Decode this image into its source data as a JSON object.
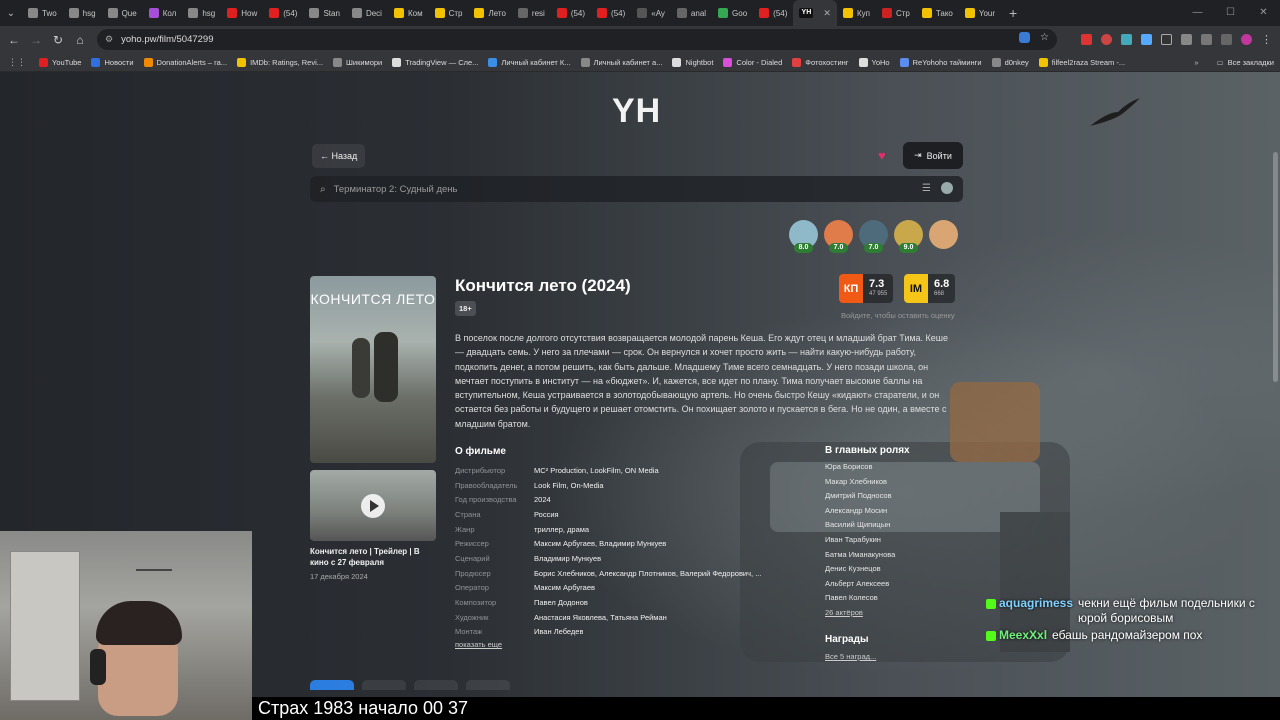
{
  "browser": {
    "tabs": [
      {
        "label": "Two",
        "color": "#888"
      },
      {
        "label": "hsg",
        "color": "#888"
      },
      {
        "label": "Que",
        "color": "#888"
      },
      {
        "label": "Кол",
        "color": "#a64ed6"
      },
      {
        "label": "hsg",
        "color": "#888"
      },
      {
        "label": "How",
        "color": "#e02020"
      },
      {
        "label": "(54)",
        "color": "#e02020"
      },
      {
        "label": "Stan",
        "color": "#888"
      },
      {
        "label": "Deci",
        "color": "#888"
      },
      {
        "label": "Ком",
        "color": "#f2c200"
      },
      {
        "label": "Стр",
        "color": "#f2c200"
      },
      {
        "label": "Лето",
        "color": "#f2c200"
      },
      {
        "label": "resi",
        "color": "#666"
      },
      {
        "label": "(54)",
        "color": "#e02020"
      },
      {
        "label": "(54)",
        "color": "#e02020"
      },
      {
        "label": "«Ay",
        "color": "#555"
      },
      {
        "label": "anal",
        "color": "#666"
      },
      {
        "label": "Goo",
        "color": "#34a853"
      },
      {
        "label": "(54)",
        "color": "#e02020"
      },
      {
        "label": "",
        "color": "#111",
        "active": true
      },
      {
        "label": "Куп",
        "color": "#f2c200"
      },
      {
        "label": "Стр",
        "color": "#cc2222"
      },
      {
        "label": "Тако",
        "color": "#f2c200"
      },
      {
        "label": "Your",
        "color": "#f2c200"
      }
    ],
    "active_tab_icon": "YH",
    "url": "yoho.pw/film/5047299"
  },
  "bookmarks": [
    {
      "label": "YouTube",
      "color": "#e02020"
    },
    {
      "label": "Новости",
      "color": "#2f6fdf"
    },
    {
      "label": "DonationAlerts – га...",
      "color": "#f08a00"
    },
    {
      "label": "IMDb: Ratings, Revi...",
      "color": "#f2c200"
    },
    {
      "label": "Шикимори",
      "color": "#888"
    },
    {
      "label": "TradingView — Сле...",
      "color": "#ddd"
    },
    {
      "label": "Личный кабинет К...",
      "color": "#3a8ee6"
    },
    {
      "label": "Личный кабинет а...",
      "color": "#888"
    },
    {
      "label": "Nightbot",
      "color": "#ddd"
    },
    {
      "label": "Color - Dialed",
      "color": "#d94fd9"
    },
    {
      "label": "Фотохостинг",
      "color": "#e04040"
    },
    {
      "label": "YoHo",
      "color": "#ddd"
    },
    {
      "label": "ReYohoho тайминги",
      "color": "#5a8dee"
    },
    {
      "label": "d0nkey",
      "color": "#888"
    },
    {
      "label": "filfeel2raza Stream -...",
      "color": "#f2c200"
    }
  ],
  "bookmarks_all": "Все закладки",
  "site": {
    "logo": "YH",
    "back": "← Назад",
    "login": "Войти",
    "search_placeholder": "Терминатор 2: Судный день",
    "avatar_scores": [
      "8.0",
      "7.0",
      "7.0",
      "9.0",
      ""
    ]
  },
  "film": {
    "title": "Кончится лето (2024)",
    "age": "18+",
    "poster_text": "КОНЧИТСЯ ЛЕТО",
    "kp_logo": "КП",
    "kp_rating": "7.3",
    "kp_votes": "47 955",
    "imdb_logo": "IM",
    "imdb_rating": "6.8",
    "imdb_votes": "668",
    "rate_hint": "Войдите, чтобы оставить оценку",
    "description": "В поселок после долгого отсутствия возвращается молодой парень Кеша. Его ждут отец и младший брат Тима. Кеше — двадцать семь. У него за плечами — срок. Он вернулся и хочет просто жить — найти какую-нибудь работу, подкопить денег, а потом решить, как быть дальше. Младшему Тиме всего семнадцать. У него позади школа, он мечтает поступить в институт — на «бюджет». И, кажется, все идет по плану. Тима получает высокие баллы на вступительном, Кеша устраивается в золотодобывающую артель. Но очень быстро Кешу «кидают» старатели, и он остается без работы и будущего и решает отомстить. Он похищает золото и пускается в бега. Но не один, а вместе с младшим братом.",
    "about_title": "О фильме",
    "info": [
      {
        "k": "Дистрибьютор",
        "v": "MC² Production, LookFilm, ON Media"
      },
      {
        "k": "Правообладатель",
        "v": "Look Film, On-Media"
      },
      {
        "k": "Год производства",
        "v": "2024"
      },
      {
        "k": "Страна",
        "v": "Россия"
      },
      {
        "k": "Жанр",
        "v": "триллер, драма"
      },
      {
        "k": "Режиссер",
        "v": "Максим Арбугаев, Владимир Мункуев"
      },
      {
        "k": "Сценарий",
        "v": "Владимир Мункуев"
      },
      {
        "k": "Продюсер",
        "v": "Борис Хлебников, Александр Плотников, Валерий Федорович, ..."
      },
      {
        "k": "Оператор",
        "v": "Максим Арбугаев"
      },
      {
        "k": "Композитор",
        "v": "Павел Додонов"
      },
      {
        "k": "Художник",
        "v": "Анастасия Яковлева, Татьяна Рейман"
      },
      {
        "k": "Монтаж",
        "v": "Иван Лебедев"
      }
    ],
    "show_more": "показать еще",
    "cast_title": "В главных ролях",
    "cast": [
      "Юра Борисов",
      "Макар Хлебников",
      "Дмитрий Подносов",
      "Александр Мосин",
      "Василий Щипицын",
      "Иван Тарабукин",
      "Батма Иманакунова",
      "Денис Кузнецов",
      "Альберт Алексеев",
      "Павел Колесов"
    ],
    "cast_more": "26 актёров",
    "awards_title": "Награды",
    "awards_link": "Все 5 наград..."
  },
  "trailer": {
    "title": "Кончится лето | Трейлер | В кино с 27 февраля",
    "date": "17 декабря 2024"
  },
  "stream": {
    "subtitle": "Страх 1983 начало 00 37",
    "chat": [
      {
        "user": "aquagrimess",
        "text": "чекни ещё фильм подельники с юрой борисовым"
      },
      {
        "user": "MeexXxl",
        "text": "ебашь рандомайзером пох"
      }
    ]
  }
}
